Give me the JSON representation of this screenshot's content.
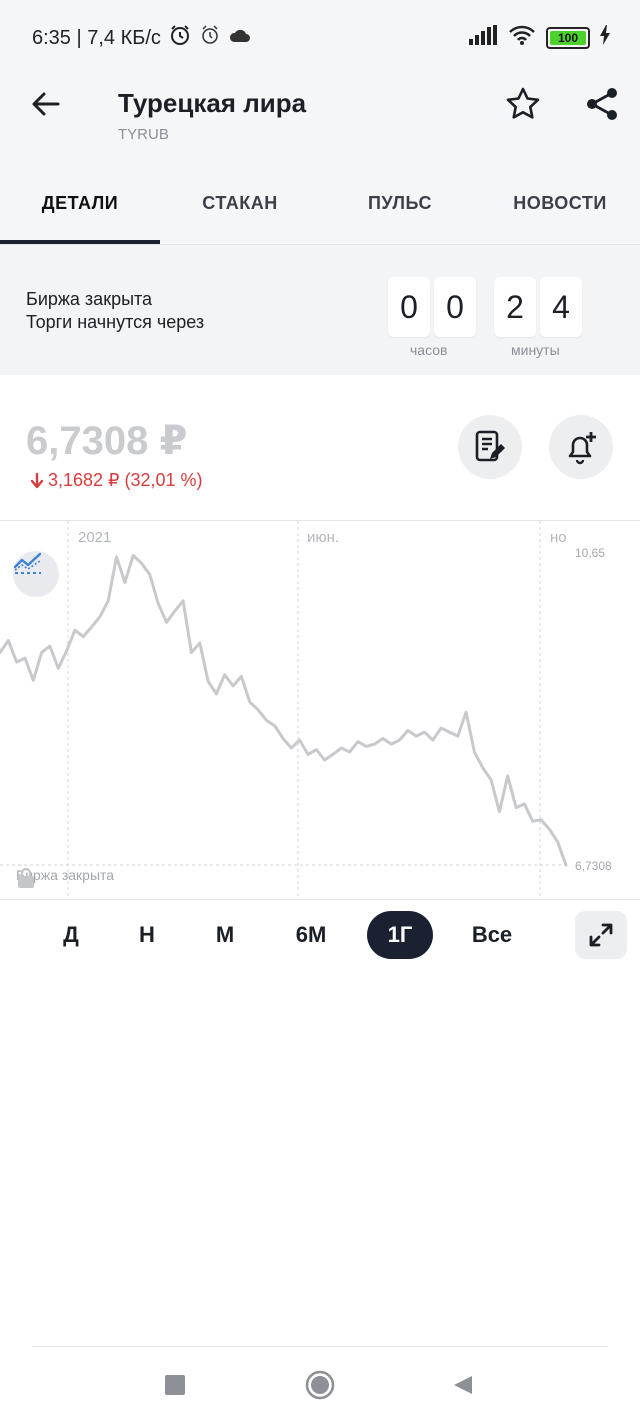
{
  "status_bar": {
    "time_speed": "6:35 | 7,4 КБ/с",
    "battery": "100",
    "icons": [
      "alarm-icon",
      "alarm-clock-icon",
      "cloud-icon",
      "signal-icon",
      "wifi-icon",
      "battery-icon",
      "charging-icon"
    ]
  },
  "header": {
    "title": "Турецкая лира",
    "ticker": "TYRUB"
  },
  "tabs": [
    {
      "label": "ДЕТАЛИ",
      "active": true
    },
    {
      "label": "СТАКАН",
      "active": false
    },
    {
      "label": "ПУЛЬС",
      "active": false
    },
    {
      "label": "НОВОСТИ",
      "active": false
    }
  ],
  "market_status": {
    "line1": "Биржа закрыта",
    "line2": "Торги начнутся через",
    "countdown": {
      "hours": [
        "0",
        "0"
      ],
      "minutes": [
        "2",
        "4"
      ],
      "hours_label": "часов",
      "minutes_label": "минуты"
    }
  },
  "quote": {
    "price": "6,7308 ₽",
    "change": "3,1682 ₽ (32,01 %)",
    "direction": "down",
    "down_color": "#d93c3c"
  },
  "chart": {
    "x_labels": [
      "2021",
      "июн.",
      "но"
    ],
    "y_max_label": "10,65",
    "y_last_label": "6,7308",
    "closed_note": "Биржа закрыта",
    "line_color": "#c8c9cc"
  },
  "chart_data": {
    "type": "line",
    "title": "",
    "xlabel": "",
    "ylabel": "",
    "ylim": [
      6.7308,
      10.65
    ],
    "x_tick_labels": [
      "2021",
      "июн.",
      "но"
    ],
    "y_tick_labels": [
      "10,65",
      "6,7308"
    ],
    "grid": true,
    "series": [
      {
        "values": [
          9.4,
          9.55,
          9.28,
          9.33,
          9.05,
          9.4,
          9.48,
          9.2,
          9.42,
          9.68,
          9.6,
          9.72,
          9.85,
          10.05,
          10.6,
          10.28,
          10.62,
          10.52,
          10.38,
          10.02,
          9.78,
          9.92,
          10.05,
          9.4,
          9.52,
          9.04,
          8.88,
          9.12,
          8.98,
          9.1,
          8.78,
          8.68,
          8.55,
          8.48,
          8.32,
          8.2,
          8.3,
          8.12,
          8.18,
          8.05,
          8.12,
          8.2,
          8.15,
          8.28,
          8.22,
          8.25,
          8.32,
          8.25,
          8.3,
          8.42,
          8.35,
          8.4,
          8.3,
          8.45,
          8.4,
          8.35,
          8.65,
          8.15,
          7.95,
          7.8,
          7.4,
          7.85,
          7.45,
          7.5,
          7.28,
          7.3,
          7.18,
          7.02,
          6.73
        ]
      }
    ]
  },
  "periods": [
    {
      "label": "Д",
      "active": false
    },
    {
      "label": "Н",
      "active": false
    },
    {
      "label": "М",
      "active": false
    },
    {
      "label": "6М",
      "active": false
    },
    {
      "label": "1Г",
      "active": true
    },
    {
      "label": "Все",
      "active": false
    }
  ]
}
